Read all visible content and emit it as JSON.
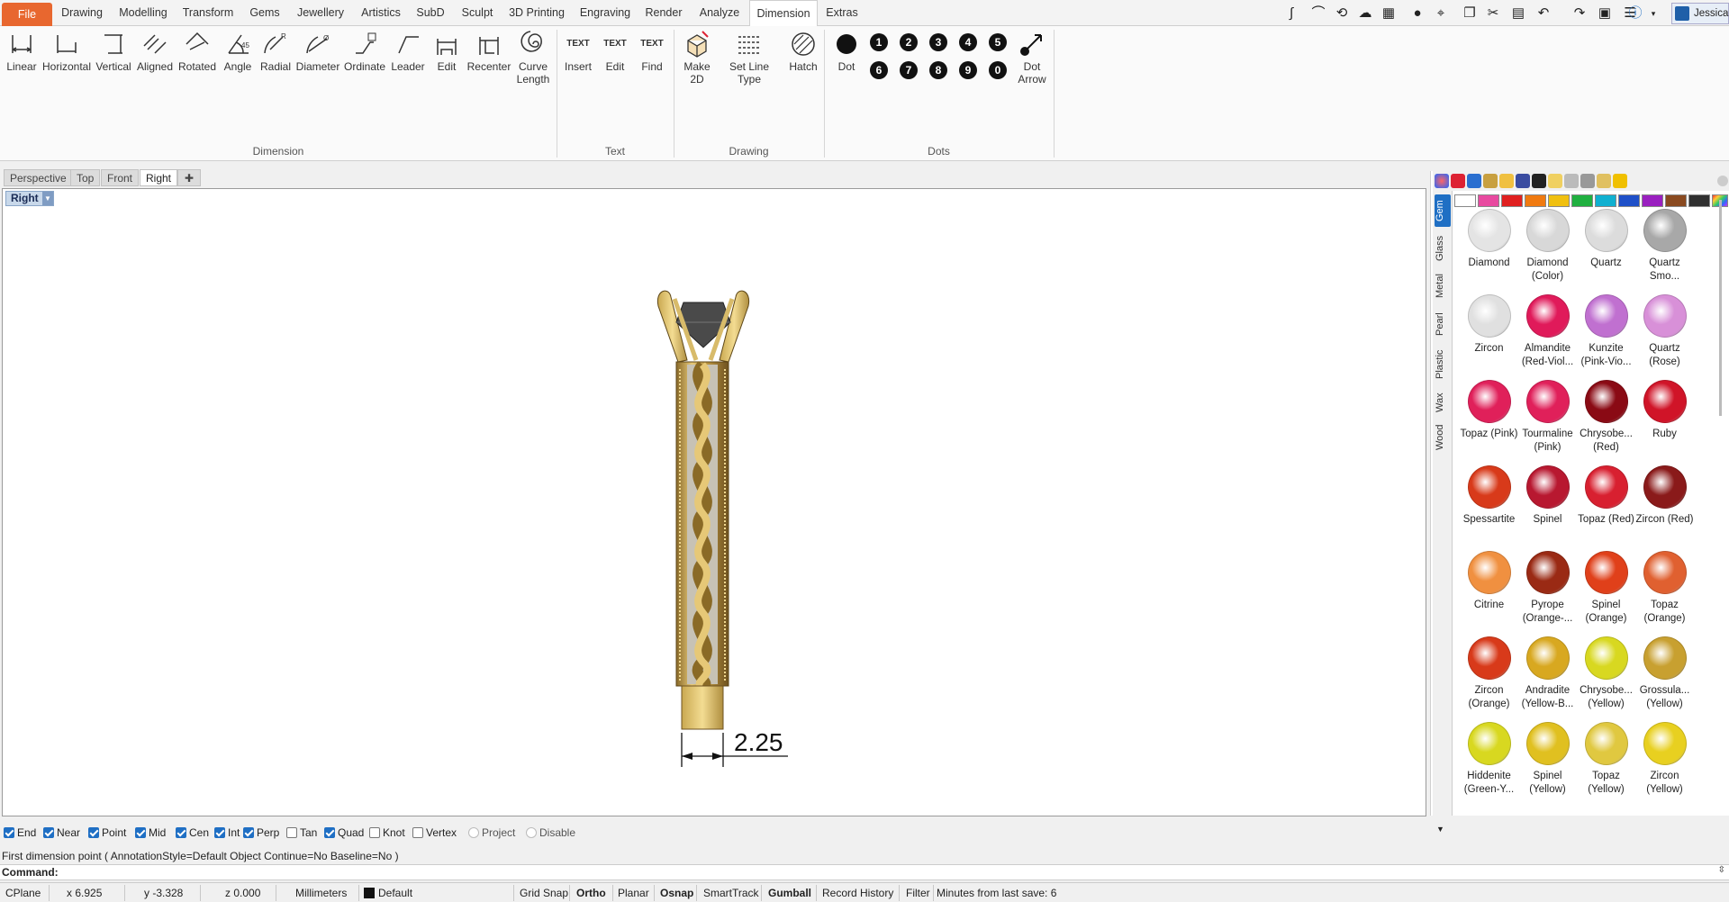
{
  "menu": {
    "file": "File",
    "tabs": [
      "Drawing",
      "Modelling",
      "Transform",
      "Gems",
      "Jewellery",
      "Artistics",
      "SubD",
      "Sculpt",
      "3D Printing",
      "Engraving",
      "Render",
      "Analyze",
      "Dimension",
      "Extras"
    ],
    "active_tab": "Dimension",
    "user": "Jessica"
  },
  "ribbon": {
    "dimension_group": {
      "label": "Dimension",
      "buttons": [
        "Linear",
        "Horizontal",
        "Vertical",
        "Aligned",
        "Rotated",
        "Angle",
        "Radial",
        "Diameter",
        "Ordinate",
        "Leader",
        "Edit",
        "Recenter",
        "Curve Length"
      ]
    },
    "text_group": {
      "label": "Text",
      "buttons": [
        "Insert",
        "Edit",
        "Find"
      ],
      "icon_text": "TEXT"
    },
    "drawing_group": {
      "label": "Drawing",
      "buttons": [
        "Make 2D",
        "Set Line Type",
        "Hatch"
      ]
    },
    "dots_group": {
      "label": "Dots",
      "dot_label": "Dot",
      "numbers": [
        "1",
        "2",
        "3",
        "4",
        "5",
        "6",
        "7",
        "8",
        "9",
        "0"
      ],
      "arrow_label": "Dot Arrow"
    }
  },
  "viewport_tabs": [
    "Perspective",
    "Top",
    "Front",
    "Right"
  ],
  "active_viewport": "Right",
  "viewport": {
    "label": "Right",
    "dimension_value": "2.25"
  },
  "gem_panel": {
    "vertical_tabs": [
      "Gem",
      "Glass",
      "Metal",
      "Pearl",
      "Plastic",
      "Wax",
      "Wood"
    ],
    "active_tab": "Gem",
    "swatch_colors": [
      "#ffffff",
      "#e84aa0",
      "#e02020",
      "#f07a10",
      "#f0c010",
      "#20b040",
      "#10b0d0",
      "#1f50c8",
      "#9a20c0",
      "#8a4a20",
      "#303030"
    ],
    "gems": [
      {
        "name": "Diamond",
        "color": "#e4e4e4"
      },
      {
        "name": "Diamond (Color)",
        "color": "#d8d8d8"
      },
      {
        "name": "Quartz",
        "color": "#dcdcdc"
      },
      {
        "name": "Quartz Smo...",
        "color": "#a8a8a8"
      },
      {
        "name": "Zircon",
        "color": "#e0e0e0"
      },
      {
        "name": "Almandite (Red-Viol...",
        "color": "#e01a5a"
      },
      {
        "name": "Kunzite (Pink-Vio...",
        "color": "#c070d0"
      },
      {
        "name": "Quartz (Rose)",
        "color": "#d890d8"
      },
      {
        "name": "Topaz (Pink)",
        "color": "#e0205a"
      },
      {
        "name": "Tourmaline (Pink)",
        "color": "#e0205a"
      },
      {
        "name": "Chrysobe... (Red)",
        "color": "#8a0a14"
      },
      {
        "name": "Ruby",
        "color": "#d01428"
      },
      {
        "name": "Spessartite",
        "color": "#d83a1a"
      },
      {
        "name": "Spinel",
        "color": "#b81830"
      },
      {
        "name": "Topaz (Red)",
        "color": "#d82030"
      },
      {
        "name": "Zircon (Red)",
        "color": "#8a1a1a"
      },
      {
        "name": "Citrine",
        "color": "#f09040"
      },
      {
        "name": "Pyrope (Orange-...",
        "color": "#9a2a14"
      },
      {
        "name": "Spinel (Orange)",
        "color": "#e0401a"
      },
      {
        "name": "Topaz (Orange)",
        "color": "#e06030"
      },
      {
        "name": "Zircon (Orange)",
        "color": "#d83a1a"
      },
      {
        "name": "Andradite (Yellow-B...",
        "color": "#d8a820"
      },
      {
        "name": "Chrysobe... (Yellow)",
        "color": "#d8d820"
      },
      {
        "name": "Grossula... (Yellow)",
        "color": "#c8a030"
      },
      {
        "name": "Hiddenite (Green-Y...",
        "color": "#d8d820"
      },
      {
        "name": "Spinel (Yellow)",
        "color": "#e0c020"
      },
      {
        "name": "Topaz (Yellow)",
        "color": "#e0c840"
      },
      {
        "name": "Zircon (Yellow)",
        "color": "#e8d020"
      }
    ]
  },
  "osnaps": [
    {
      "label": "End",
      "checked": true
    },
    {
      "label": "Near",
      "checked": true
    },
    {
      "label": "Point",
      "checked": true
    },
    {
      "label": "Mid",
      "checked": true
    },
    {
      "label": "Cen",
      "checked": true
    },
    {
      "label": "Int",
      "checked": true
    },
    {
      "label": "Perp",
      "checked": true
    },
    {
      "label": "Tan",
      "checked": false
    },
    {
      "label": "Quad",
      "checked": true
    },
    {
      "label": "Knot",
      "checked": false
    },
    {
      "label": "Vertex",
      "checked": false
    },
    {
      "label": "Project",
      "checked": false,
      "disabled": true
    },
    {
      "label": "Disable",
      "checked": false,
      "disabled": true
    }
  ],
  "command": {
    "history": "First dimension point ( AnnotationStyle=Default  Object  Continue=No  Baseline=No )",
    "prompt": "Command:"
  },
  "statusbar": {
    "cplane": "CPlane",
    "x": "x 6.925",
    "y": "y -3.328",
    "z": "z 0.000",
    "units": "Millimeters",
    "layer": "Default",
    "grid_snap": "Grid Snap",
    "ortho": "Ortho",
    "planar": "Planar",
    "osnap": "Osnap",
    "smarttrack": "SmartTrack",
    "gumball": "Gumball",
    "record_history": "Record History",
    "filter": "Filter",
    "last_save": "Minutes from last save: 6"
  }
}
